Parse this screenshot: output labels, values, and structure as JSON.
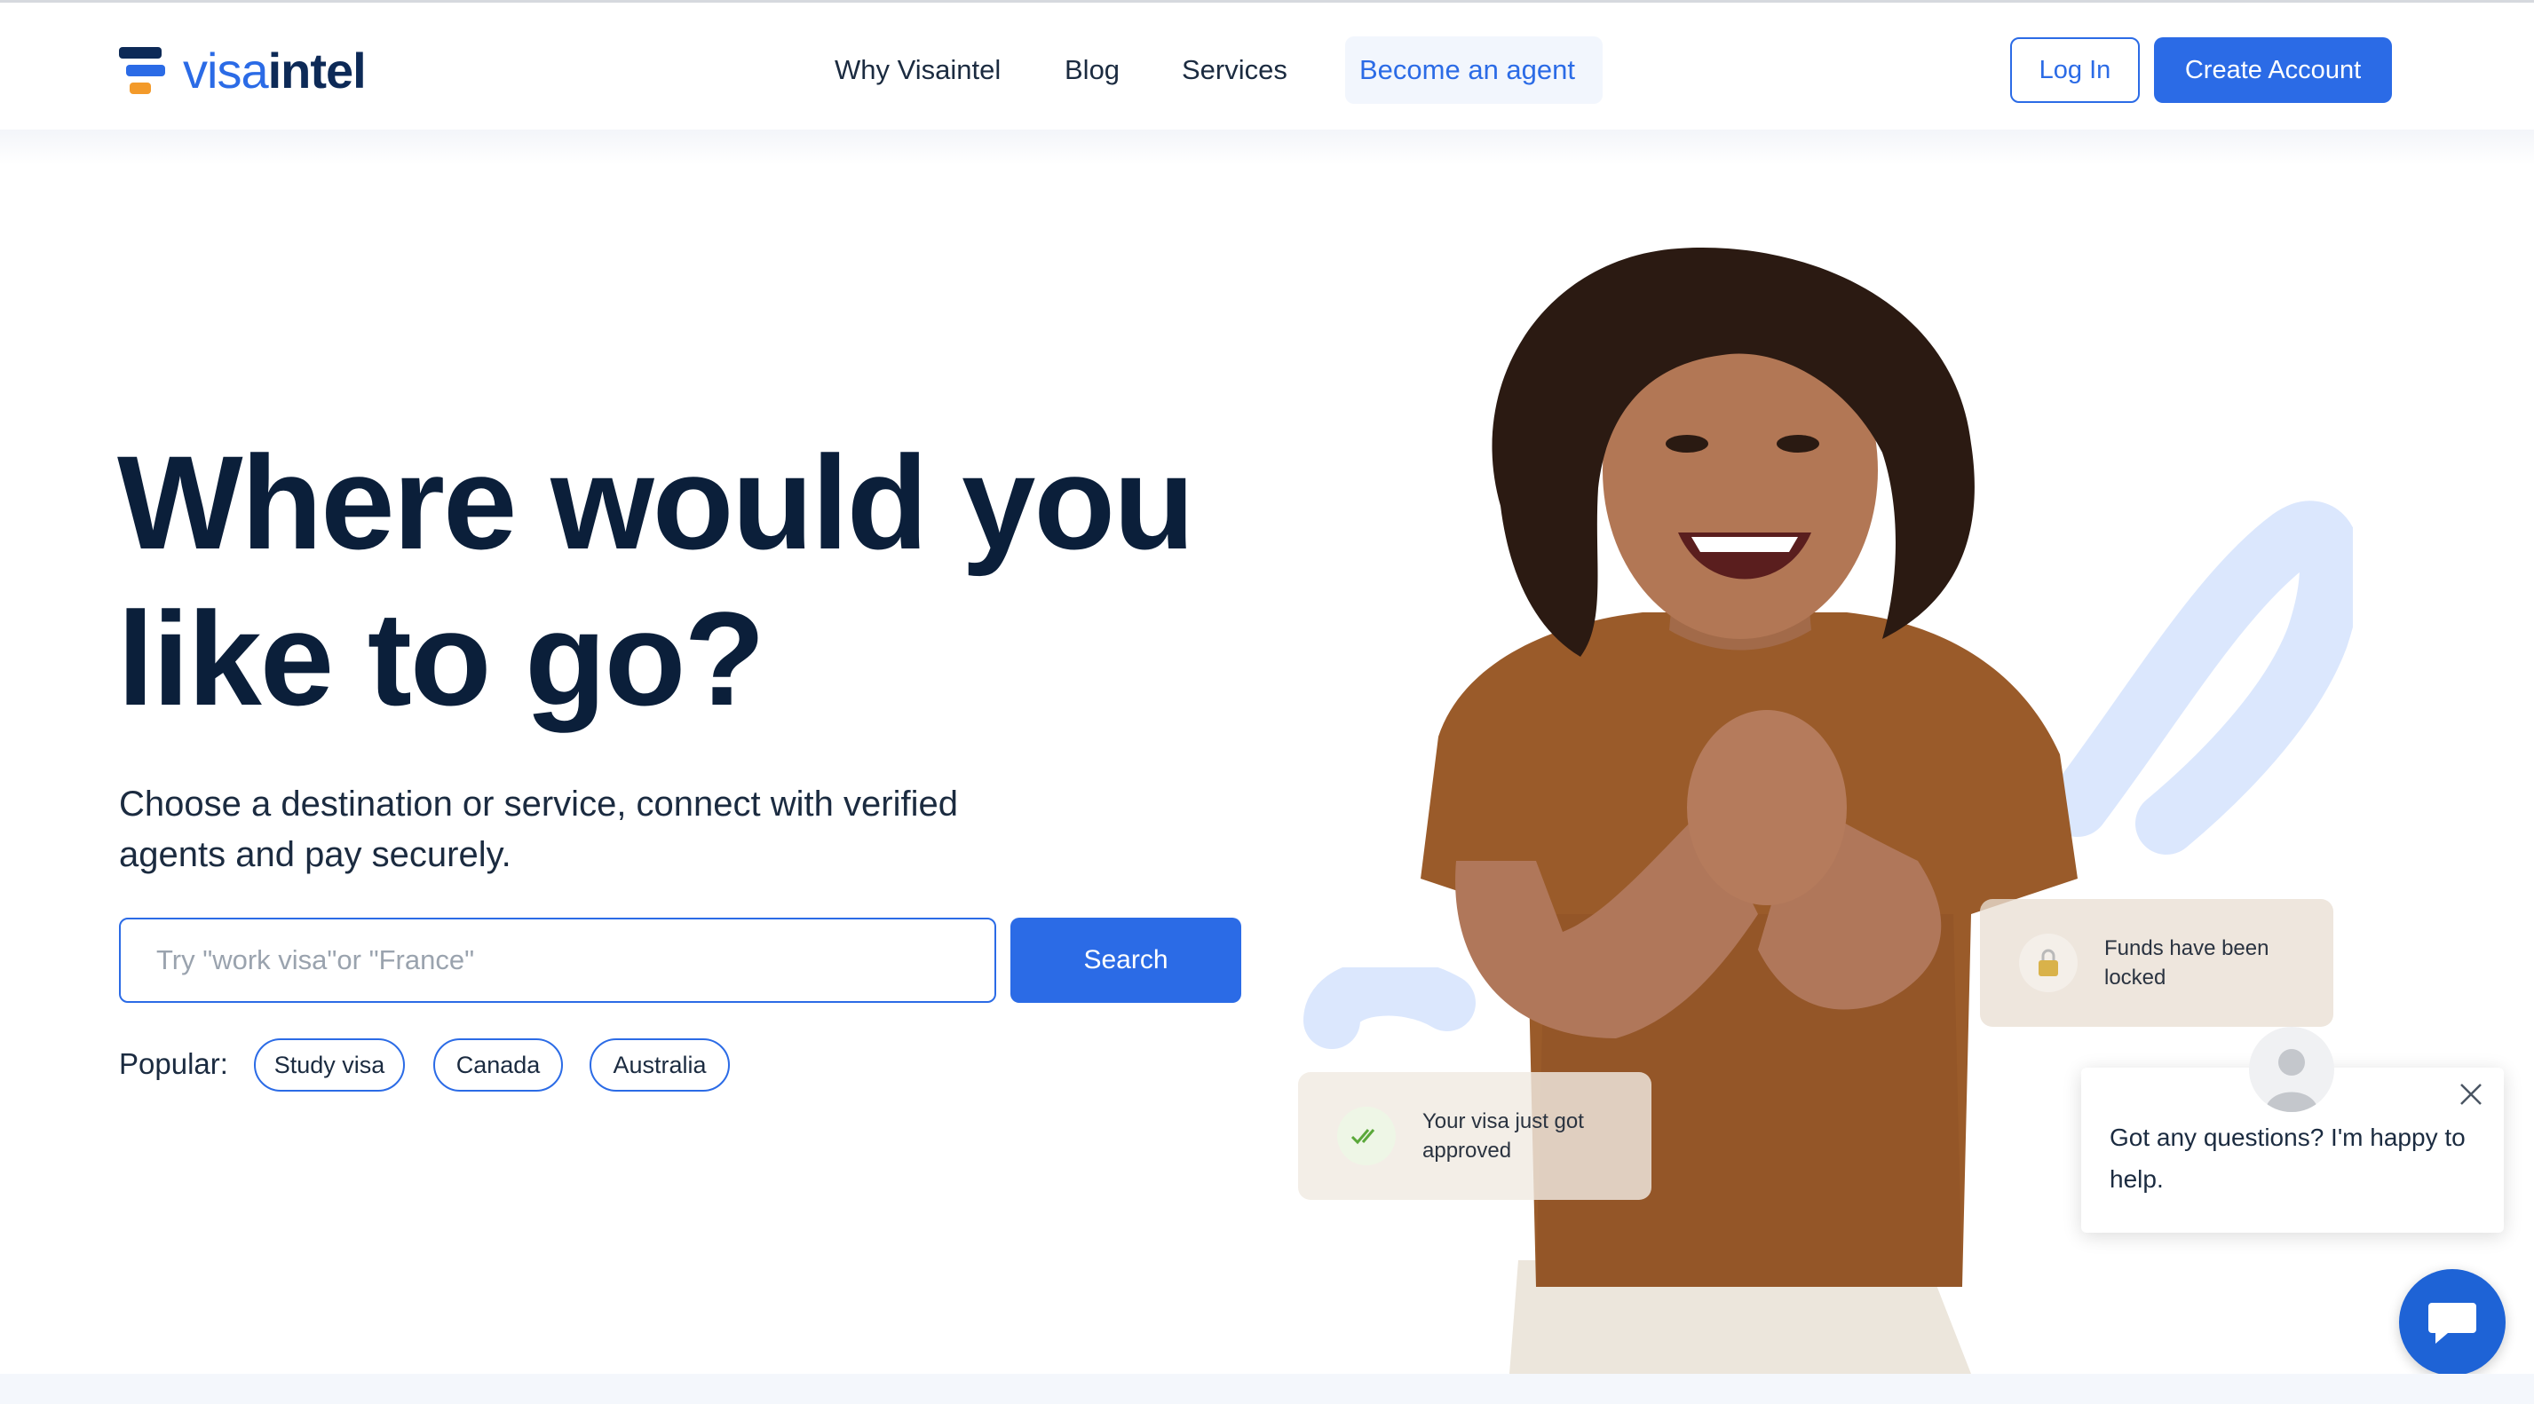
{
  "header": {
    "logo": {
      "part1": "visa",
      "part2": "intel"
    },
    "nav": [
      {
        "label": "Why Visaintel"
      },
      {
        "label": "Blog"
      },
      {
        "label": "Services"
      },
      {
        "label": "Become an agent"
      }
    ],
    "login_label": "Log In",
    "create_account_label": "Create Account"
  },
  "hero": {
    "title_line1": "Where would you",
    "title_line2": "like to go?",
    "subtitle": "Choose a destination or service, connect with verified agents and pay securely.",
    "search": {
      "placeholder": "Try \"work visa\"or \"France\"",
      "button_label": "Search"
    },
    "popular_label": "Popular:",
    "popular_chips": [
      "Study visa",
      "Canada",
      "Australia"
    ]
  },
  "cards": {
    "funds": {
      "text": "Funds have been locked",
      "icon": "lock-icon"
    },
    "visa": {
      "text": "Your visa just got approved",
      "icon": "double-check-icon"
    }
  },
  "chat": {
    "message": "Got any questions? I'm happy to help.",
    "icon": "chat-bubble-icon"
  },
  "colors": {
    "primary": "#2b6be6",
    "navy": "#0b1f3a",
    "logo_orange": "#f39a2a",
    "swoosh": "#dbe7fd"
  }
}
